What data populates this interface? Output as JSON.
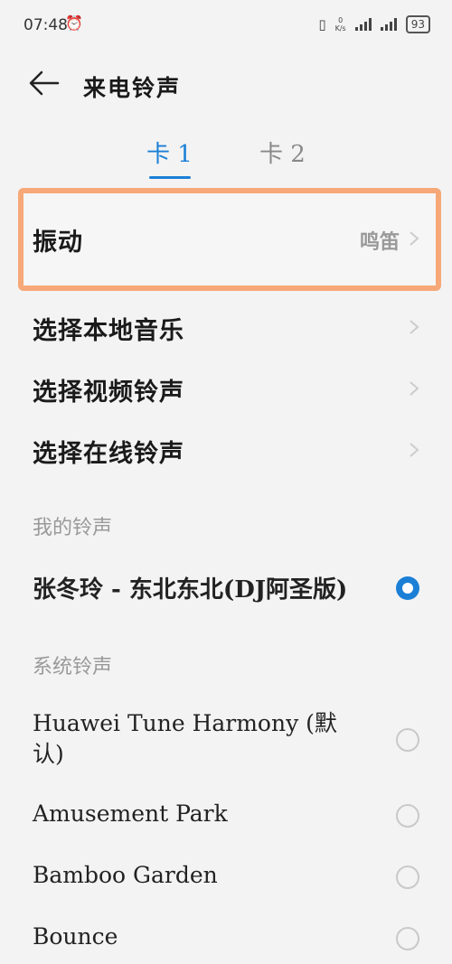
{
  "status_bar": {
    "time": "07:48",
    "net_speed_value": "0",
    "net_speed_unit": "K/s",
    "battery": "93"
  },
  "header": {
    "title": "来电铃声"
  },
  "tabs": [
    {
      "label": "卡 1"
    },
    {
      "label": "卡 2"
    }
  ],
  "settings": [
    {
      "label": "振动",
      "value": "鸣笛"
    },
    {
      "label": "选择本地音乐"
    },
    {
      "label": "选择视频铃声"
    },
    {
      "label": "选择在线铃声"
    }
  ],
  "my_ringtones": {
    "header": "我的铃声",
    "items": [
      {
        "label": "张冬玲 - 东北东北(DJ阿圣版)",
        "selected": true
      }
    ]
  },
  "system_ringtones": {
    "header": "系统铃声",
    "items": [
      {
        "label": "Huawei Tune Harmony (默认)",
        "selected": false
      },
      {
        "label": "Amusement Park",
        "selected": false
      },
      {
        "label": "Bamboo Garden",
        "selected": false
      },
      {
        "label": "Bounce",
        "selected": false
      }
    ]
  },
  "colors": {
    "accent": "#1b7fd6",
    "highlight_border": "#f6a878"
  }
}
